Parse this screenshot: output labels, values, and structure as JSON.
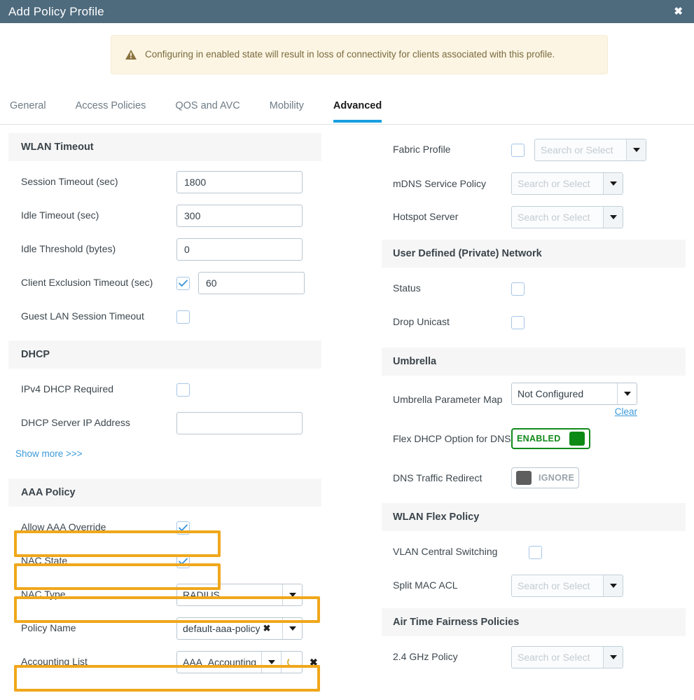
{
  "window": {
    "title": "Add Policy Profile",
    "close_icon": "close-icon"
  },
  "banner": {
    "icon": "warning-triangle-icon",
    "message": "Configuring in enabled state will result in loss of connectivity for clients associated with this profile."
  },
  "tabs": [
    {
      "label": "General",
      "active": false
    },
    {
      "label": "Access Policies",
      "active": false
    },
    {
      "label": "QOS and AVC",
      "active": false
    },
    {
      "label": "Mobility",
      "active": false
    },
    {
      "label": "Advanced",
      "active": true
    }
  ],
  "left": {
    "wlan_timeout": {
      "heading": "WLAN Timeout",
      "session_timeout_label": "Session Timeout (sec)",
      "session_timeout_value": "1800",
      "idle_timeout_label": "Idle Timeout (sec)",
      "idle_timeout_value": "300",
      "idle_threshold_label": "Idle Threshold (bytes)",
      "idle_threshold_value": "0",
      "client_exclusion_label": "Client Exclusion Timeout (sec)",
      "client_exclusion_value": "60",
      "guest_lan_label": "Guest LAN Session Timeout"
    },
    "dhcp": {
      "heading": "DHCP",
      "ipv4_required_label": "IPv4 DHCP Required",
      "server_ip_label": "DHCP Server IP Address",
      "server_ip_value": ""
    },
    "show_more": "Show more >>>",
    "aaa_policy": {
      "heading": "AAA Policy",
      "allow_override_label": "Allow AAA Override",
      "nac_state_label": "NAC State",
      "nac_type_label": "NAC Type",
      "nac_type_value": "RADIUS",
      "policy_name_label": "Policy Name",
      "policy_name_value": "default-aaa-policy",
      "accounting_list_label": "Accounting List",
      "accounting_list_value": "AAA_Accounting_C"
    }
  },
  "right": {
    "fabric_profile_label": "Fabric Profile",
    "fabric_profile_placeholder": "Search or Select",
    "mdns_label": "mDNS Service Policy",
    "mdns_placeholder": "Search or Select",
    "hotspot_label": "Hotspot Server",
    "hotspot_placeholder": "Search or Select",
    "udn": {
      "heading": "User Defined (Private) Network",
      "status_label": "Status",
      "drop_unicast_label": "Drop Unicast"
    },
    "umbrella": {
      "heading": "Umbrella",
      "param_map_label": "Umbrella Parameter Map",
      "param_map_value": "Not Configured",
      "clear_link": "Clear",
      "flex_dhcp_label": "Flex DHCP Option for DNS",
      "flex_dhcp_state": "ENABLED",
      "dns_redirect_label": "DNS Traffic Redirect",
      "dns_redirect_state": "IGNORE"
    },
    "wlan_flex": {
      "heading": "WLAN Flex Policy",
      "vlan_central_label": "VLAN Central Switching",
      "split_mac_label": "Split MAC ACL",
      "split_mac_placeholder": "Search or Select"
    },
    "atf": {
      "heading": "Air Time Fairness Policies",
      "ghz24_label": "2.4 GHz Policy",
      "ghz24_placeholder": "Search or Select"
    }
  },
  "colors": {
    "titlebar": "#4e6a7d",
    "highlight": "#f0a71b",
    "accent_tab": "#1aa0e0",
    "enabled_green": "#0c8a15",
    "link_blue": "#3b9ad9"
  }
}
